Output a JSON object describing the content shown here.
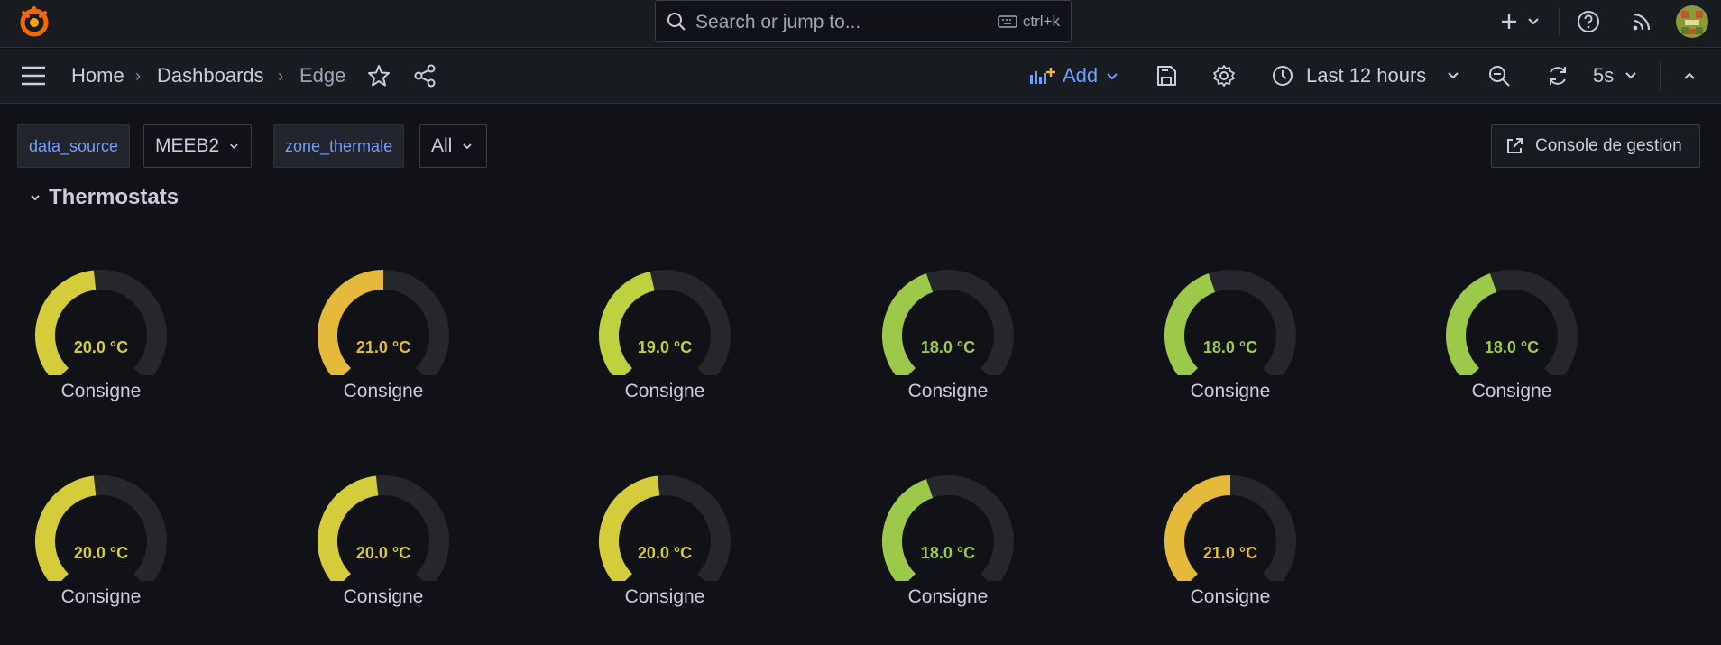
{
  "topbar": {
    "search_placeholder": "Search or jump to...",
    "search_shortcut": "ctrl+k",
    "icons": [
      "grafana-logo-icon",
      "search-icon",
      "keyboard-icon",
      "plus-icon",
      "chevron-down-icon",
      "help-icon",
      "rss-icon",
      "avatar"
    ]
  },
  "nav": {
    "breadcrumb": [
      "Home",
      "Dashboards",
      "Edge"
    ],
    "add_label": "Add",
    "time_range": "Last 12 hours",
    "refresh_interval": "5s"
  },
  "variables": [
    {
      "name": "data_source",
      "value": "MEEB2"
    },
    {
      "name": "zone_thermale",
      "value": "All"
    }
  ],
  "console_button": "Console de gestion",
  "row": {
    "title": "Thermostats"
  },
  "gauges": [
    {
      "value_text": "20.0 °C",
      "value": 20.0,
      "label": "Consigne",
      "color": "#d4cc3a"
    },
    {
      "value_text": "21.0 °C",
      "value": 21.0,
      "label": "Consigne",
      "color": "#e5b93a"
    },
    {
      "value_text": "19.0 °C",
      "value": 19.0,
      "label": "Consigne",
      "color": "#bed13f"
    },
    {
      "value_text": "18.0 °C",
      "value": 18.0,
      "label": "Consigne",
      "color": "#9cc94a"
    },
    {
      "value_text": "18.0 °C",
      "value": 18.0,
      "label": "Consigne",
      "color": "#9cc94a"
    },
    {
      "value_text": "18.0 °C",
      "value": 18.0,
      "label": "Consigne",
      "color": "#9cc94a"
    },
    {
      "value_text": "20.0 °C",
      "value": 20.0,
      "label": "Consigne",
      "color": "#d4cc3a"
    },
    {
      "value_text": "20.0 °C",
      "value": 20.0,
      "label": "Consigne",
      "color": "#d4cc3a"
    },
    {
      "value_text": "20.0 °C",
      "value": 20.0,
      "label": "Consigne",
      "color": "#d4cc3a"
    },
    {
      "value_text": "18.0 °C",
      "value": 18.0,
      "label": "Consigne",
      "color": "#9cc94a"
    },
    {
      "value_text": "21.0 °C",
      "value": 21.0,
      "label": "Consigne",
      "color": "#e5b93a"
    }
  ],
  "colors": {
    "accent": "#6e9fff",
    "track": "#25272d",
    "bg": "#111217",
    "panel": "#181b1f"
  }
}
